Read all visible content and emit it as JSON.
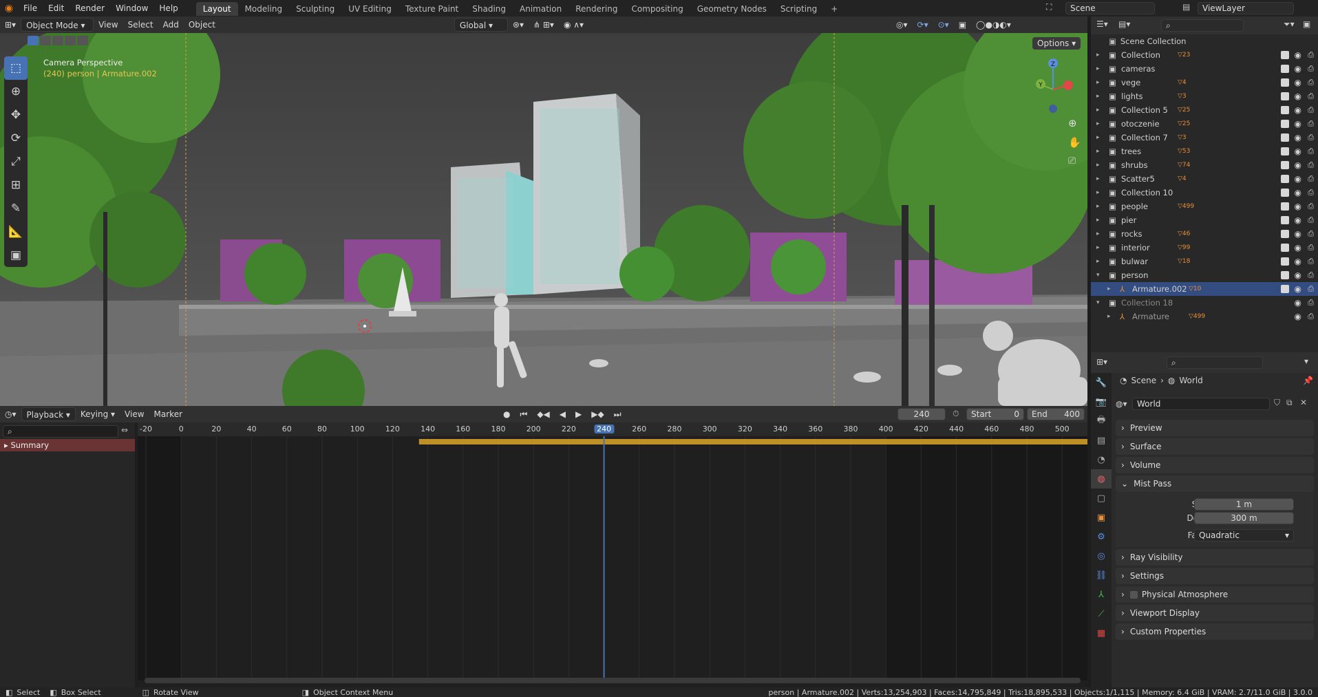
{
  "topbar": {
    "menus": [
      "File",
      "Edit",
      "Render",
      "Window",
      "Help"
    ],
    "workspaces": [
      "Layout",
      "Modeling",
      "Sculpting",
      "UV Editing",
      "Texture Paint",
      "Shading",
      "Animation",
      "Rendering",
      "Compositing",
      "Geometry Nodes",
      "Scripting"
    ],
    "active_workspace": "Layout",
    "scene": "Scene",
    "view_layer": "ViewLayer"
  },
  "viewport_header": {
    "mode": "Object Mode",
    "menus": [
      "View",
      "Select",
      "Add",
      "Object"
    ],
    "orientation": "Global",
    "options": "Options"
  },
  "viewport": {
    "overlay_title": "Camera Perspective",
    "overlay_subtitle": "(240) person | Armature.002",
    "gizmo": {
      "z": "Z",
      "y": "Y"
    }
  },
  "outliner": {
    "root": "Scene Collection",
    "rows": [
      {
        "name": "Collection",
        "count": "23"
      },
      {
        "name": "cameras",
        "count": ""
      },
      {
        "name": "vege",
        "count": "4"
      },
      {
        "name": "lights",
        "count": "3"
      },
      {
        "name": "Collection 5",
        "count": "25"
      },
      {
        "name": "otoczenie",
        "count": "25"
      },
      {
        "name": "Collection 7",
        "count": "3"
      },
      {
        "name": "trees",
        "count": "53"
      },
      {
        "name": "shrubs",
        "count": "74"
      },
      {
        "name": "Scatter5",
        "count": "4"
      },
      {
        "name": "Collection 10",
        "count": ""
      },
      {
        "name": "people",
        "count": "499"
      },
      {
        "name": "pier",
        "count": ""
      },
      {
        "name": "rocks",
        "count": "46"
      },
      {
        "name": "interior",
        "count": "99"
      },
      {
        "name": "bulwar",
        "count": "18"
      },
      {
        "name": "person",
        "count": ""
      },
      {
        "name": "Armature.002",
        "count": "10"
      },
      {
        "name": "Collection 18",
        "count": ""
      },
      {
        "name": "Armature",
        "count": "499"
      }
    ]
  },
  "properties": {
    "breadcrumb_scene": "Scene",
    "breadcrumb_world": "World",
    "world_name": "World",
    "panels": [
      "Preview",
      "Surface",
      "Volume"
    ],
    "mist": {
      "title": "Mist Pass",
      "start_label": "Start",
      "start_value": "1 m",
      "depth_label": "Depth",
      "depth_value": "300 m",
      "falloff_label": "Falloff",
      "falloff_value": "Quadratic"
    },
    "panels_after": [
      "Ray Visibility",
      "Settings",
      "Physical Atmosphere",
      "Viewport Display",
      "Custom Properties"
    ]
  },
  "timeline": {
    "menus": [
      "Playback",
      "Keying",
      "View",
      "Marker"
    ],
    "current_frame": "240",
    "start_label": "Start",
    "start": "0",
    "end_label": "End",
    "end": "400",
    "summary": "Summary",
    "ticks": [
      "-20",
      "0",
      "20",
      "40",
      "60",
      "80",
      "100",
      "120",
      "140",
      "160",
      "180",
      "200",
      "220",
      "240",
      "260",
      "280",
      "300",
      "320",
      "340",
      "360",
      "380",
      "400",
      "420",
      "440",
      "460",
      "480",
      "500"
    ]
  },
  "statusbar": {
    "select": "Select",
    "box_select": "Box Select",
    "rotate": "Rotate View",
    "context": "Object Context Menu",
    "stats": "person | Armature.002 | Verts:13,254,903 | Faces:14,795,849 | Tris:18,895,533 | Objects:1/1,115 | Memory: 6.4 GiB | VRAM: 2.7/11.0 GiB | 3.0.0"
  }
}
